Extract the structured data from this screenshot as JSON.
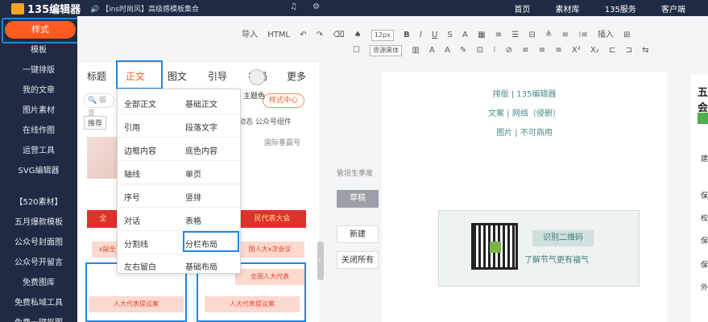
{
  "topbar": {
    "logo": "135编辑器",
    "announce": "🔊 【ins时尚风】高级感模板集合",
    "icons": "♫ ⚙",
    "nav": [
      "首页",
      "素材库",
      "135服务",
      "客户端"
    ]
  },
  "sidebar": {
    "active": "样式",
    "items": [
      "模板",
      "一键排版",
      "我的文章",
      "图片素材",
      "在线作图",
      "运营工具",
      "SVG编辑器"
    ],
    "extra": [
      "【520素材】",
      "五月爆款模板",
      "公众号封面图",
      "公众号开留言",
      "免费图库",
      "免费私域工具",
      "免费一键抠图"
    ]
  },
  "toolbar": {
    "row1": [
      "导入",
      "HTML",
      "↶",
      "↷",
      "⌫",
      "♠",
      "12px",
      "B",
      "I",
      "U",
      "S",
      "A",
      "▦",
      "≡",
      "☰",
      "⊟",
      "≜",
      "≡",
      "⁝≡",
      "插入",
      "⊞"
    ],
    "row2_font": "思源黑体",
    "row2": [
      "▥",
      "A",
      "A",
      "✎",
      "⊡",
      "⁝",
      "⊘",
      "≡",
      "≡",
      "≡",
      "X²",
      "X₂",
      "⊏",
      "⊐",
      "⇆"
    ]
  },
  "tabs": {
    "items": [
      "标题",
      "正文",
      "图文",
      "引导",
      "布局",
      "更多"
    ],
    "active": "正文",
    "theme": "主题色"
  },
  "panel": {
    "search_placeholder": "留言",
    "style_center": "样式中心",
    "recommend": "推荐",
    "tag_right": "动态  公众号组件",
    "right_caption": "国际垂赢号",
    "banner_left": "全",
    "banner_right": "民代表大会",
    "pink_buttons": [
      "x届全",
      "国人大x次会议",
      "全国人大代表",
      "人大代表提议案",
      "人大代表提议案"
    ]
  },
  "dropdown": {
    "items": [
      [
        "全部正文",
        "基础正文"
      ],
      [
        "引用",
        "段落文字"
      ],
      [
        "边框内容",
        "底色内容"
      ],
      [
        "轴线",
        "单页"
      ],
      [
        "序号",
        "竖排"
      ],
      [
        "对话",
        "表格"
      ],
      [
        "分割线",
        "分栏布局"
      ],
      [
        "左右留白",
        "基础布局"
      ]
    ],
    "highlighted": "分栏布局"
  },
  "middle": {
    "input": "管培生季度",
    "draft": "草稿",
    "new": "新建",
    "close_all": "关闭所有"
  },
  "canvas": {
    "lines": [
      "排版 | 135编辑器",
      "文案 | 网络（侵删）",
      "图片 | 不可商用"
    ],
    "qr_button": "识别二维码",
    "qr_text": "了解节气更有福气"
  },
  "right": {
    "title": "五会",
    "labels": [
      "建",
      "保",
      "校",
      "保",
      "保",
      "外"
    ]
  }
}
